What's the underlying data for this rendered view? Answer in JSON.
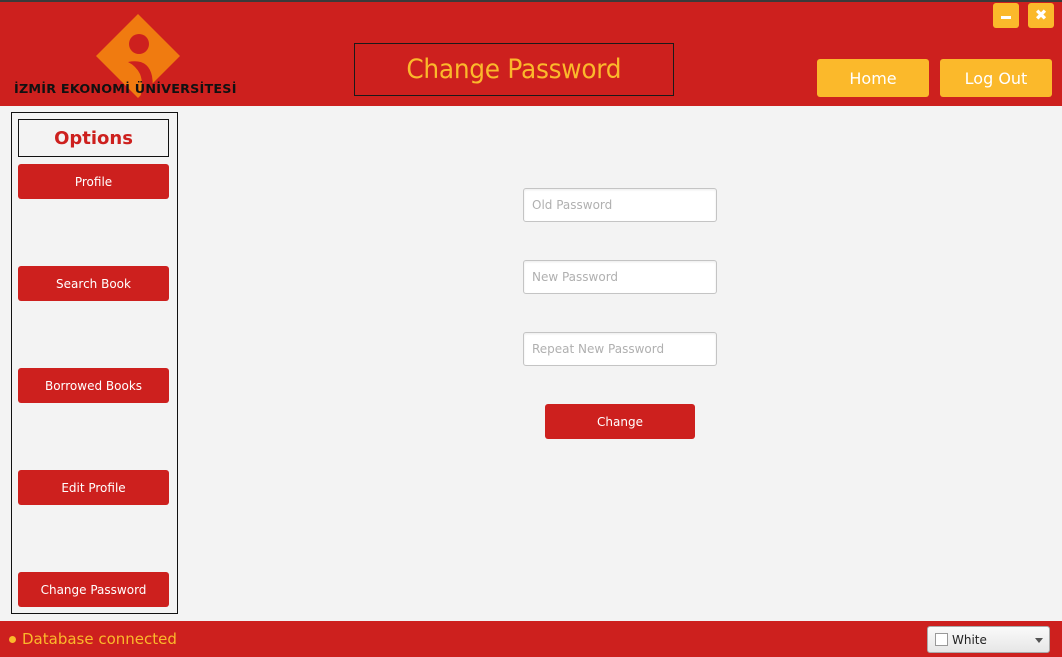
{
  "app": {
    "brand_text": "İZMİR EKONOMİ ÜNİVERSİTESİ",
    "page_title": "Change Password"
  },
  "window_controls": {
    "minimize_icon": "minimize-icon",
    "close_icon": "close-icon",
    "close_glyph": "✖"
  },
  "header": {
    "nav": [
      {
        "label": "Home"
      },
      {
        "label": "Log Out"
      }
    ]
  },
  "sidebar": {
    "title": "Options",
    "items": [
      {
        "label": "Profile"
      },
      {
        "label": "Search Book"
      },
      {
        "label": "Borrowed Books"
      },
      {
        "label": "Edit Profile"
      },
      {
        "label": "Change Password"
      }
    ]
  },
  "form": {
    "fields": [
      {
        "placeholder": "Old Password",
        "value": ""
      },
      {
        "placeholder": "New Password",
        "value": ""
      },
      {
        "placeholder": "Repeat New Password",
        "value": ""
      }
    ],
    "submit_label": "Change"
  },
  "footer": {
    "status_text": "Database connected",
    "theme_select": {
      "selected": "White"
    }
  },
  "colors": {
    "primary_red": "#cd201e",
    "accent_yellow": "#fbb92b",
    "logo_orange": "#f07b10",
    "background": "#f3f3f3"
  }
}
